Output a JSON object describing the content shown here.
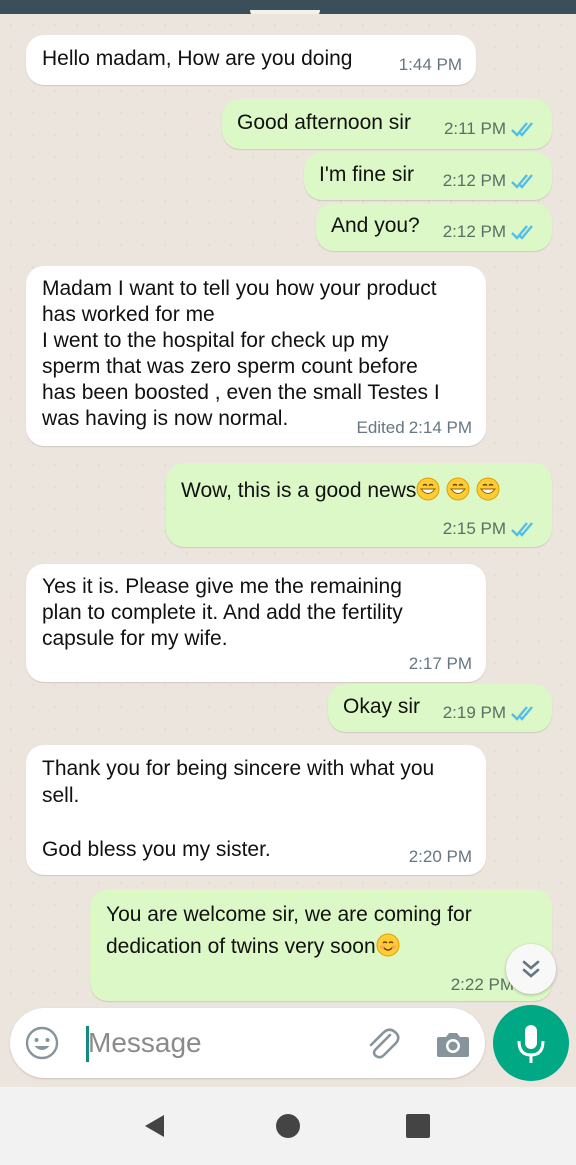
{
  "colors": {
    "incoming_bubble": "#ffffff",
    "outgoing_bubble": "#dcf8c6",
    "read_ticks": "#53bdeb",
    "accent": "#00a884"
  },
  "messages": [
    {
      "direction": "in",
      "text": "Hello madam, How are you doing",
      "time": "1:44 PM"
    },
    {
      "direction": "out",
      "text": "Good afternoon sir",
      "time": "2:11 PM",
      "status": "read"
    },
    {
      "direction": "out",
      "text": "I'm fine sir",
      "time": "2:12 PM",
      "status": "read"
    },
    {
      "direction": "out",
      "text": "And you?",
      "time": "2:12 PM",
      "status": "read"
    },
    {
      "direction": "in",
      "text": "Madam I want to tell you how your product\nhas worked for me\nI went to the hospital for check up my\nsperm that was zero sperm count before\nhas been boosted , even the small Testes I\nwas having is now normal.",
      "edited_label": "Edited",
      "time": "2:14 PM"
    },
    {
      "direction": "out",
      "text": "Wow, this is a good news",
      "emoji": "grinning-face-with-smiling-eyes x3",
      "time": "2:15 PM",
      "status": "read"
    },
    {
      "direction": "in",
      "text": "Yes it is. Please give me the remaining\nplan to complete it. And add the fertility\ncapsule for my wife.",
      "time": "2:17 PM"
    },
    {
      "direction": "out",
      "text": "Okay sir",
      "time": "2:19 PM",
      "status": "read"
    },
    {
      "direction": "in",
      "text": "Thank you for being sincere with what you\nsell.\n\nGod bless you my sister.",
      "time": "2:20 PM"
    },
    {
      "direction": "out",
      "text": "You are welcome sir, we are coming for\ndedication of twins very soon",
      "emoji": "smiling-face-with-smiling-eyes",
      "time": "2:22 PM",
      "status": "read"
    }
  ],
  "composer": {
    "placeholder": "Message"
  },
  "icons": {
    "emoji": "smiley-icon",
    "attach": "paperclip-icon",
    "camera": "camera-icon",
    "mic": "microphone-icon",
    "scroll": "chevrons-down-icon",
    "nav_back": "triangle-back-icon",
    "nav_home": "circle-home-icon",
    "nav_recents": "square-recents-icon"
  }
}
